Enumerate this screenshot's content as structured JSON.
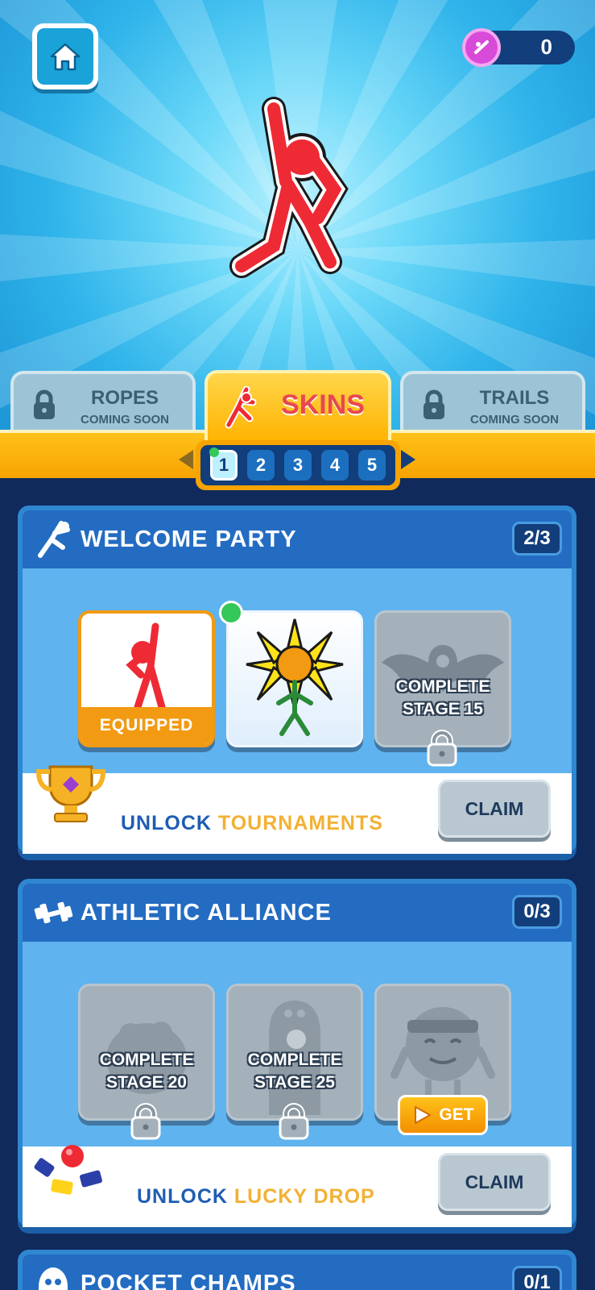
{
  "currency": {
    "amount": "0",
    "icon": "gem-coin-icon"
  },
  "tabs": [
    {
      "label": "ROPES",
      "sub": "COMING SOON",
      "locked": true
    },
    {
      "label": "SKINS",
      "active": true
    },
    {
      "label": "TRAILS",
      "sub": "COMING SOON",
      "locked": true
    }
  ],
  "pager": {
    "pages": [
      "1",
      "2",
      "3",
      "4",
      "5"
    ],
    "current": "1"
  },
  "sections": [
    {
      "title": "WELCOME PARTY",
      "count": "2/3",
      "items": [
        {
          "state": "equipped",
          "label": "EQUIPPED",
          "skin": "red-stickman"
        },
        {
          "state": "unlocked",
          "skin": "sunflower"
        },
        {
          "state": "locked",
          "req1": "COMPLETE",
          "req2": "STAGE 15",
          "skin": "bat"
        }
      ],
      "reward_prefix": "UNLOCK",
      "reward_highlight": "TOURNAMENTS",
      "claim": "CLAIM"
    },
    {
      "title": "ATHLETIC ALLIANCE",
      "count": "0/3",
      "items": [
        {
          "state": "locked",
          "req1": "COMPLETE",
          "req2": "STAGE 20"
        },
        {
          "state": "locked",
          "req1": "COMPLETE",
          "req2": "STAGE 25"
        },
        {
          "state": "ad",
          "get": "GET"
        }
      ],
      "reward_prefix": "UNLOCK",
      "reward_highlight": "LUCKY DROP",
      "claim": "CLAIM"
    },
    {
      "title": "POCKET CHAMPS",
      "count": "0/1"
    }
  ],
  "colors": {
    "accent": "#f7a300",
    "primary": "#236cc2",
    "highlight": "#f2b134"
  }
}
